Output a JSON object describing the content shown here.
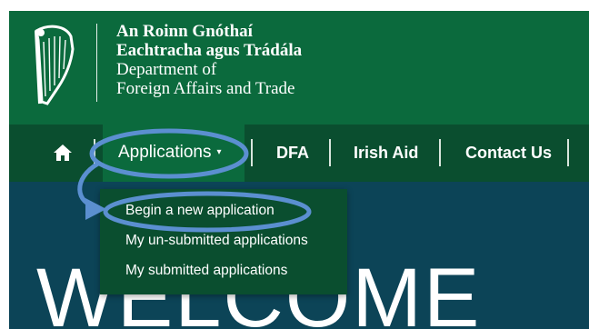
{
  "logo": {
    "line1": "An Roinn Gnóthaí",
    "line2": "Eachtracha agus Trádála",
    "line3": "Department of",
    "line4": "Foreign Affairs and Trade"
  },
  "nav": {
    "applications": "Applications",
    "caret": "▾",
    "dfa": "DFA",
    "irish_aid": "Irish Aid",
    "contact": "Contact Us"
  },
  "dropdown": {
    "items": [
      "Begin a new application",
      "My un-submitted applications",
      "My submitted applications"
    ]
  },
  "hero": {
    "title": "WELCOME"
  },
  "colors": {
    "header_green": "#0b6a3d",
    "nav_green": "#0a4e2f",
    "hero_teal": "#0c4457",
    "annotation_blue": "#5b8fd0"
  },
  "icons": {
    "home": "home-icon",
    "harp": "harp-icon"
  }
}
